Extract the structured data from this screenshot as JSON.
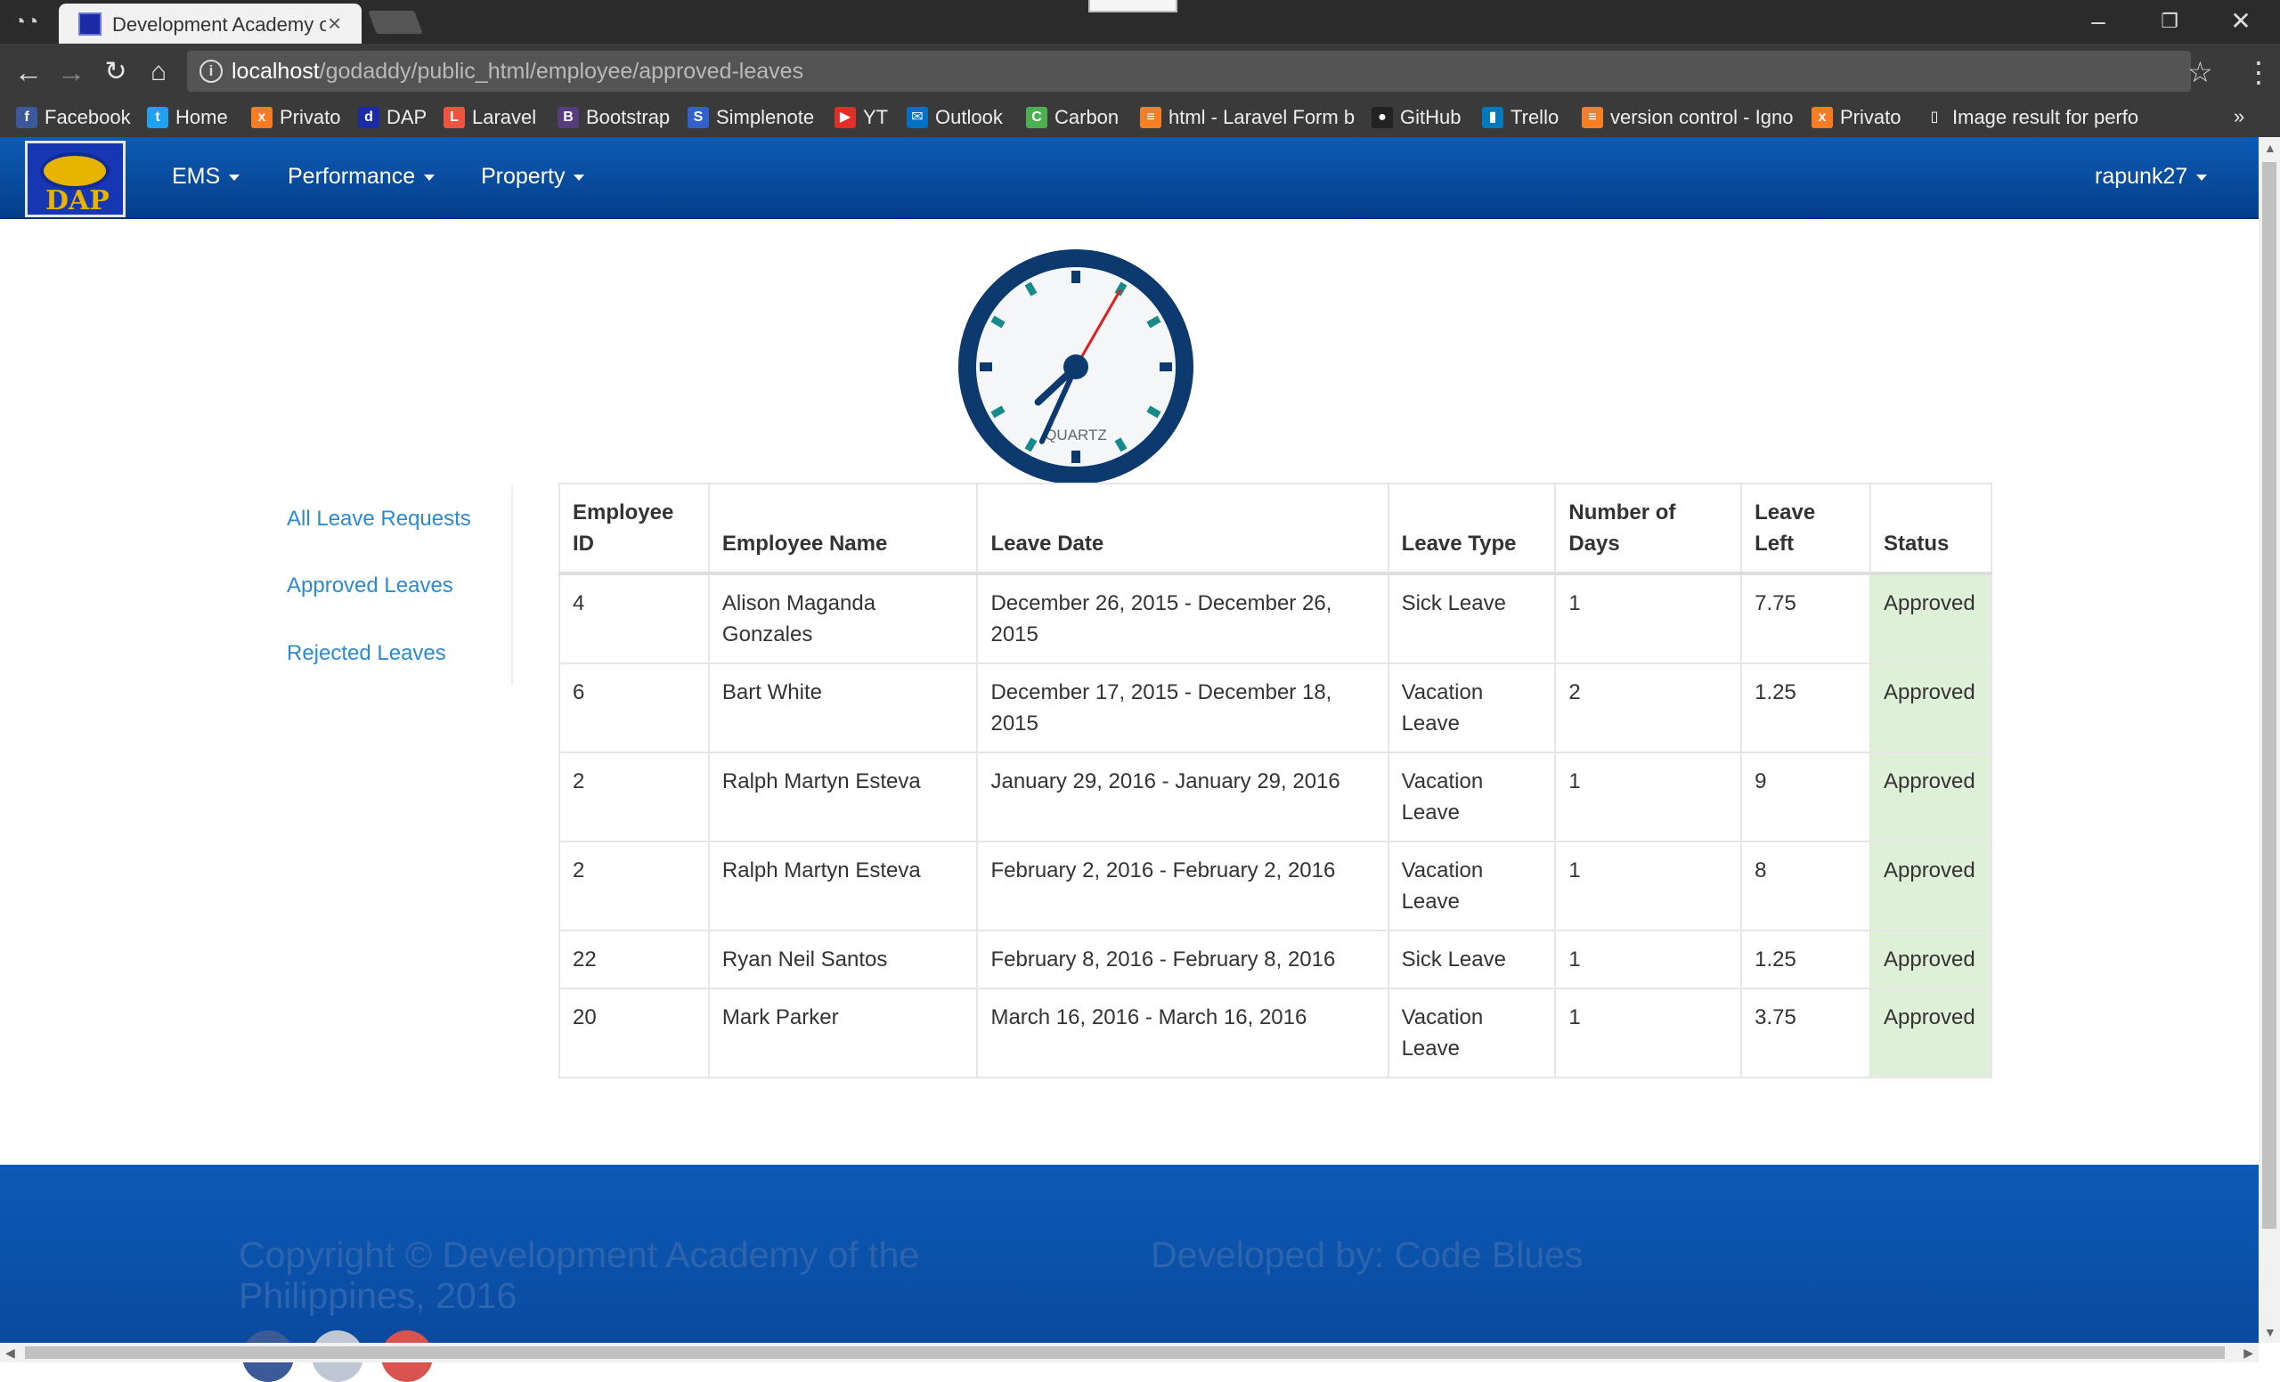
{
  "browser": {
    "tab_title": "Development Academy of the Philippines",
    "url_host": "localhost",
    "url_path": "/godaddy/public_html/employee/approved-leaves",
    "bookmarks": [
      {
        "label": "Facebook",
        "icon": "facebook-icon",
        "color": "#3b5998",
        "glyph": "f"
      },
      {
        "label": "Home",
        "icon": "twitter-icon",
        "color": "#1da1f2",
        "glyph": "t"
      },
      {
        "label": "Privato",
        "icon": "xampp-icon",
        "color": "#fb7a24",
        "glyph": "x"
      },
      {
        "label": "DAP",
        "icon": "dap-icon",
        "color": "#1a2ba5",
        "glyph": "d"
      },
      {
        "label": "Laravel",
        "icon": "laravel-icon",
        "color": "#f05340",
        "glyph": "L"
      },
      {
        "label": "Bootstrap",
        "icon": "bootstrap-icon",
        "color": "#563d7c",
        "glyph": "B"
      },
      {
        "label": "Simplenote",
        "icon": "simplenote-icon",
        "color": "#3361cc",
        "glyph": "S"
      },
      {
        "label": "YT",
        "icon": "youtube-icon",
        "color": "#e52d27",
        "glyph": "▶"
      },
      {
        "label": "Outlook",
        "icon": "outlook-icon",
        "color": "#0072c6",
        "glyph": "✉"
      },
      {
        "label": "Carbon",
        "icon": "carbon-icon",
        "color": "#4caf50",
        "glyph": "C"
      },
      {
        "label": "html - Laravel Form b",
        "icon": "stackoverflow-icon",
        "color": "#f48024",
        "glyph": "≡"
      },
      {
        "label": "GitHub",
        "icon": "github-icon",
        "color": "#222222",
        "glyph": "●"
      },
      {
        "label": "Trello",
        "icon": "trello-icon",
        "color": "#0079bf",
        "glyph": "▮"
      },
      {
        "label": "version control - Igno",
        "icon": "stackoverflow-icon",
        "color": "#f48024",
        "glyph": "≡"
      },
      {
        "label": "Privato",
        "icon": "xampp-icon",
        "color": "#fb7a24",
        "glyph": "x"
      },
      {
        "label": "Image result for perfo",
        "icon": "page-icon",
        "color": "#3a3a3a",
        "glyph": "▯"
      }
    ]
  },
  "navbar": {
    "menus": [
      "EMS",
      "Performance",
      "Property"
    ],
    "user": "rapunk27",
    "logo_text": "DAP"
  },
  "clock": {
    "label": "QUARTZ",
    "hour": 7,
    "minute": 34,
    "second": 5
  },
  "sidenav": {
    "items": [
      "All Leave Requests",
      "Approved Leaves",
      "Rejected Leaves"
    ]
  },
  "table": {
    "headers": [
      "Employee ID",
      "Employee Name",
      "Leave Date",
      "Leave Type",
      "Number of Days",
      "Leave Left",
      "Status"
    ],
    "rows": [
      [
        "4",
        "Alison Maganda Gonzales",
        "December 26, 2015 - December 26, 2015",
        "Sick Leave",
        "1",
        "7.75",
        "Approved"
      ],
      [
        "6",
        "Bart White",
        "December 17, 2015 - December 18, 2015",
        "Vacation Leave",
        "2",
        "1.25",
        "Approved"
      ],
      [
        "2",
        "Ralph Martyn Esteva",
        "January 29, 2016 - January 29, 2016",
        "Vacation Leave",
        "1",
        "9",
        "Approved"
      ],
      [
        "2",
        "Ralph Martyn Esteva",
        "February 2, 2016 - February 2, 2016",
        "Vacation Leave",
        "1",
        "8",
        "Approved"
      ],
      [
        "22",
        "Ryan Neil Santos",
        "February 8, 2016 - February 8, 2016",
        "Sick Leave",
        "1",
        "1.25",
        "Approved"
      ],
      [
        "20",
        "Mark Parker",
        "March 16, 2016 - March 16, 2016",
        "Vacation Leave",
        "1",
        "3.75",
        "Approved"
      ]
    ]
  },
  "footer": {
    "copyright": "Copyright © Development Academy of the Philippines, 2016",
    "developed": "Developed by: Code Blues"
  }
}
